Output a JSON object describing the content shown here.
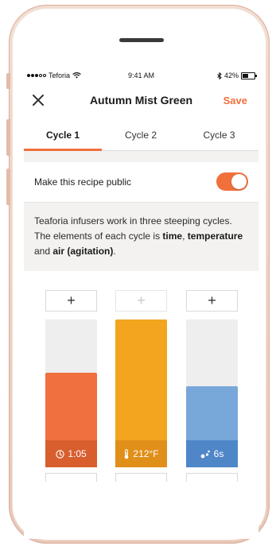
{
  "status_bar": {
    "carrier": "Teforia",
    "time": "9:41 AM",
    "battery": "42%",
    "battery_level": 0.42
  },
  "header": {
    "title": "Autumn Mist Green",
    "save_label": "Save",
    "close_icon": "close-icon"
  },
  "tabs": [
    {
      "label": "Cycle 1",
      "active": true
    },
    {
      "label": "Cycle 2",
      "active": false
    },
    {
      "label": "Cycle 3",
      "active": false
    }
  ],
  "public_toggle": {
    "label": "Make this recipe public",
    "on": true
  },
  "info": {
    "line1": "Teaforia infusers work in three steeping cycles. The elements of each cycle is ",
    "time": "time",
    "sep1": ", ",
    "temperature": "temperature",
    "sep2": " and ",
    "air": "air (agitation)",
    "end": "."
  },
  "columns": [
    {
      "name": "time",
      "plus": "+",
      "plus_enabled": true,
      "value": "1:05",
      "level": 0.64,
      "color": "#f07040",
      "badge_color": "#d95e2e",
      "icon": "clock-icon"
    },
    {
      "name": "temperature",
      "plus": "+",
      "plus_enabled": false,
      "value": "212°F",
      "level": 1.0,
      "color": "#f3a520",
      "badge_color": "#e08f19",
      "icon": "thermometer-icon"
    },
    {
      "name": "air",
      "plus": "+",
      "plus_enabled": true,
      "value": "6s",
      "level": 0.55,
      "color": "#78a7d9",
      "badge_color": "#4f86c8",
      "icon": "bubbles-icon"
    }
  ],
  "colors": {
    "accent": "#f0703c"
  }
}
